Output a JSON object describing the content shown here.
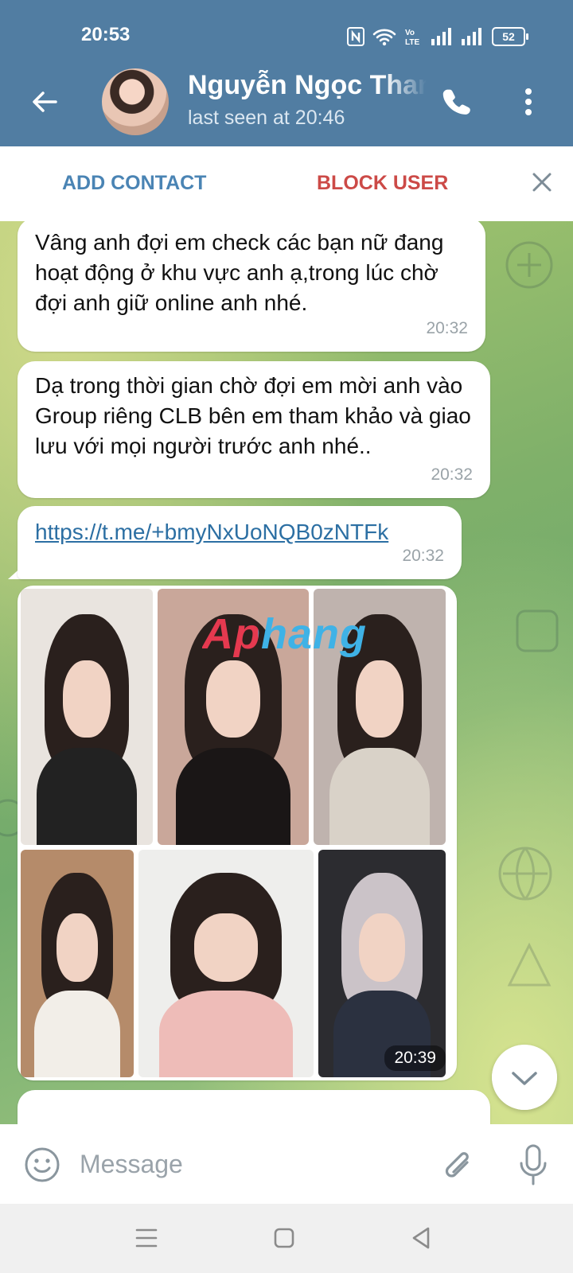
{
  "status_bar": {
    "time": "20:53",
    "battery": "52"
  },
  "header": {
    "name": "Nguyễn Ngọc Thanh",
    "last_seen": "last seen at 20:46"
  },
  "action_bar": {
    "add_contact": "ADD CONTACT",
    "block_user": "BLOCK USER"
  },
  "messages": [
    {
      "text": "Vâng anh đợi em check các bạn nữ đang hoạt động ở khu vực anh ạ,trong lúc chờ đợi anh giữ online anh nhé.",
      "time": "20:32"
    },
    {
      "text": "Dạ trong thời gian chờ đợi em mời anh vào Group riêng  CLB bên em tham khảo và giao lưu với mọi người trước anh nhé..",
      "time": "20:32"
    },
    {
      "text": "https://t.me/+bmyNxUoNQB0zNTFk",
      "time": "20:32"
    }
  ],
  "album": {
    "watermark": "Aphang",
    "time": "20:39"
  },
  "input": {
    "placeholder": "Message"
  },
  "colors": {
    "header": "#517da2",
    "add_contact": "#4a84b4",
    "block_user": "#cc4a47",
    "link": "#2c6fa3"
  }
}
